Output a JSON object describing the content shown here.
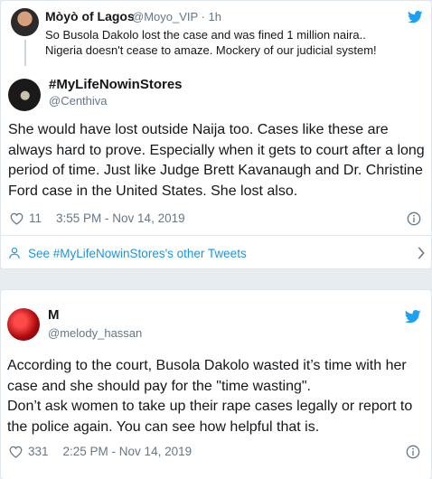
{
  "quoted_reply": {
    "name": "Mòyò of Lagos",
    "handle": "@Moyo_VIP",
    "time": "· 1h",
    "text_line1": "So Busola Dakolo lost the case and was fined 1 million naira..",
    "text_line2": "Nigeria doesn't cease to amaze. Mockery of our judicial system!"
  },
  "main_tweet": {
    "name": "#MyLifeNowinStores",
    "handle": "@Centhiva",
    "text": "She would have lost outside Naija too. Cases like these are always hard to prove. Especially when it gets to court after a long period of time. Just like Judge Brett Kavanaugh and Dr. Christine Ford case in the United States. She lost also.",
    "likes": "11",
    "timestamp": "3:55 PM - Nov 14, 2019",
    "see_more": "See #MyLifeNowinStores's other Tweets"
  },
  "second_tweet": {
    "name": "M",
    "handle": "@melody_hassan",
    "text_line1": "According to the court, Busola Dakolo wasted it’s time with her case and she should pay for the \"time wasting\".",
    "text_line2": "Don’t ask women to take up their rape cases legally or report to the police again. You can see how helpful that is.",
    "likes": "331",
    "timestamp": "2:25 PM - Nov 14, 2019"
  },
  "colors": {
    "twitter_blue": "#1da1f2",
    "link_blue": "#1b95e0",
    "secondary_text": "#657786",
    "border": "#e1e8ed"
  },
  "icons": [
    "twitter-bird-icon",
    "heart-icon",
    "info-icon",
    "person-icon",
    "chevron-right-icon"
  ]
}
